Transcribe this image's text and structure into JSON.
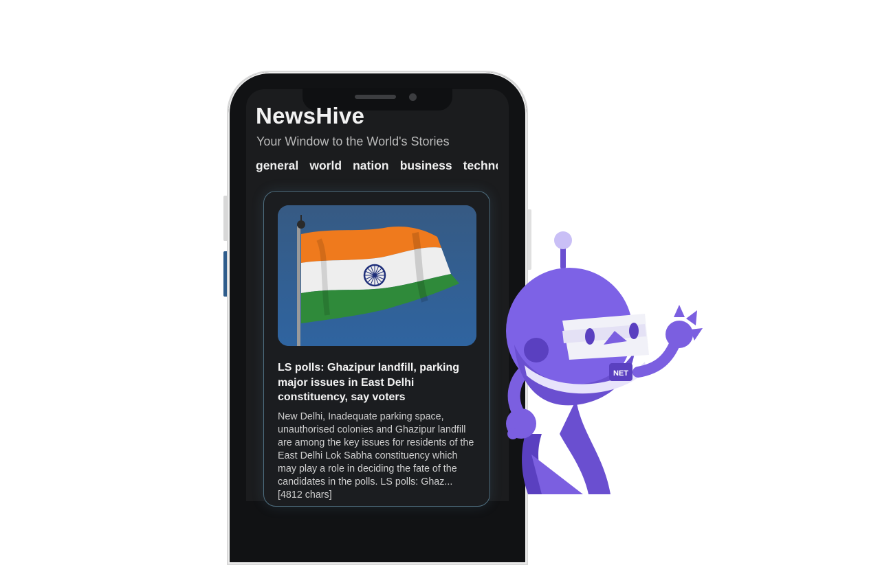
{
  "app": {
    "title": "NewsHive",
    "subtitle": "Your Window to the World's Stories"
  },
  "categories": [
    "general",
    "world",
    "nation",
    "business",
    "technology"
  ],
  "article": {
    "headline": "LS polls: Ghazipur landfill, parking major issues in East Delhi constituency, say voters",
    "summary": "New Delhi, Inadequate parking space, unauthorised colonies and Ghazipur landfill are among the key issues for residents of the East Delhi Lok Sabha constituency which may play a role in deciding the fate of the candidates in the polls. LS polls: Ghaz... [4812 chars]",
    "image_icon": "indian-flag-image"
  },
  "mascot": {
    "badge_text": "NET",
    "icon": "dotnet-bot-mascot"
  },
  "colors": {
    "screen_bg": "#1b1c1e",
    "card_border": "#4f6f80",
    "mascot_purple": "#7b5fe0",
    "flag_saffron": "#f07a1c",
    "flag_green": "#2f8a3a",
    "chakra_navy": "#1f2f7a"
  }
}
